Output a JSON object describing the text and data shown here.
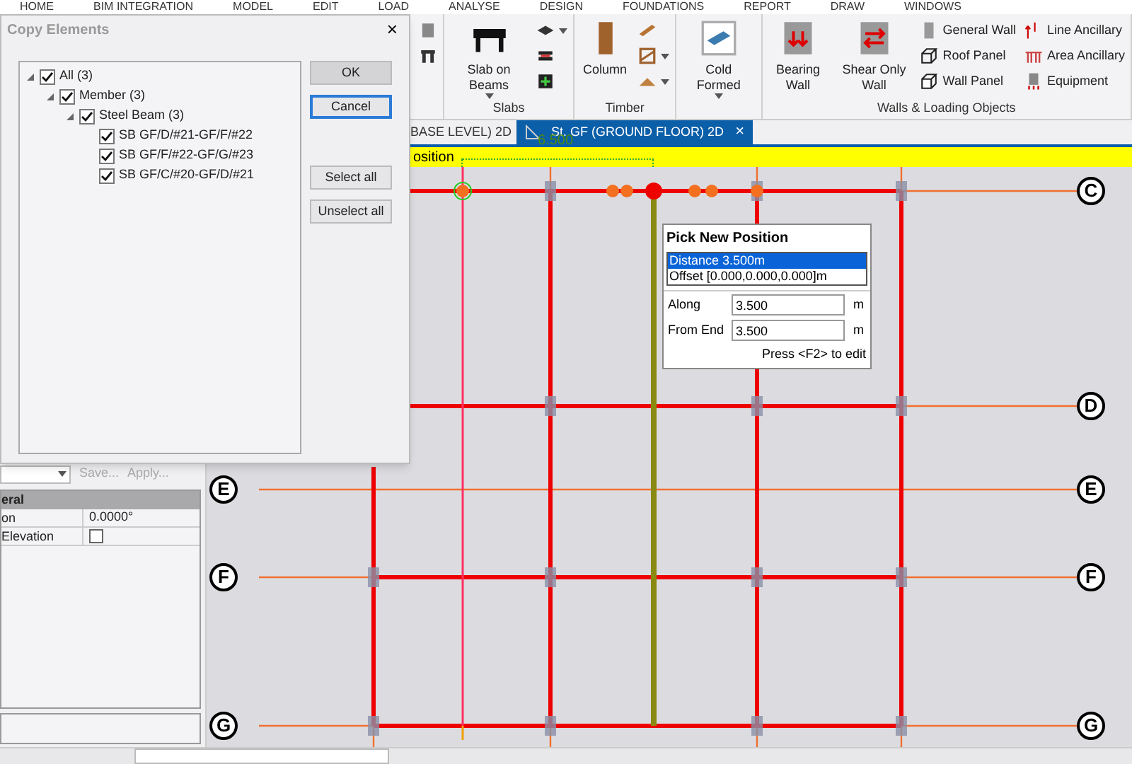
{
  "menu": [
    "HOME",
    "BIM INTEGRATION",
    "MODEL",
    "EDIT",
    "LOAD",
    "ANALYSE",
    "DESIGN",
    "FOUNDATIONS",
    "REPORT",
    "DRAW",
    "WINDOWS"
  ],
  "ribbon": {
    "groups": [
      {
        "items": [
          {
            "kind": "stack",
            "entries": [
              {
                "dropdown": false
              },
              {
                "dropdown": false
              }
            ]
          }
        ]
      },
      {
        "label": "Slabs",
        "items": [
          {
            "kind": "large",
            "label": "Slab on Beams",
            "dropdown": true
          },
          {
            "kind": "stack",
            "entries": [
              {
                "dropdown": true
              },
              {
                "dropdown": false
              },
              {
                "dropdown": false
              }
            ]
          }
        ]
      },
      {
        "label": "Timber",
        "items": [
          {
            "kind": "large",
            "label": "Column",
            "dropdown": false
          },
          {
            "kind": "stack",
            "entries": [
              {
                "dropdown": false
              },
              {
                "dropdown": true
              },
              {
                "dropdown": true
              }
            ]
          }
        ]
      },
      {
        "items": [
          {
            "kind": "large",
            "label": "Cold Formed",
            "dropdown": true
          }
        ]
      },
      {
        "label": "Walls & Loading Objects",
        "items": [
          {
            "kind": "large",
            "label": "Bearing Wall",
            "dropdown": false
          },
          {
            "kind": "large",
            "label": "Shear Only Wall",
            "dropdown": false
          },
          {
            "kind": "stack",
            "entries": [
              {
                "label": "General Wall",
                "dropdown": false
              },
              {
                "label": "Roof Panel",
                "dropdown": false
              },
              {
                "label": "Wall Panel",
                "dropdown": false
              }
            ]
          },
          {
            "kind": "stack",
            "entries": [
              {
                "label": "Line Ancillary",
                "dropdown": false
              },
              {
                "label": "Area Ancillary",
                "dropdown": false
              },
              {
                "label": "Equipment",
                "dropdown": false
              }
            ]
          }
        ]
      }
    ]
  },
  "tabs": [
    {
      "label": "BASE LEVEL) 2D",
      "selected": false
    },
    {
      "label": "St. GF (GROUND FLOOR) 2D",
      "selected": true,
      "close": "×"
    }
  ],
  "prompt_bar": {
    "text": "osition",
    "dimension": "6.500"
  },
  "grid": {
    "rows": [
      {
        "right_label": "C"
      },
      {
        "right_label": "D"
      },
      {
        "left_label": "E",
        "right_label": "E"
      },
      {
        "left_label": "F",
        "right_label": "F"
      },
      {
        "left_label": "G",
        "right_label": "G"
      }
    ]
  },
  "pick_popup": {
    "title": "Pick New Position",
    "options": [
      {
        "label": "Distance 3.500m",
        "selected": true
      },
      {
        "label": "Offset [0.000,0.000,0.000]m",
        "selected": false
      }
    ],
    "fields": [
      {
        "label": "Along",
        "value": "3.500",
        "unit": "m"
      },
      {
        "label": "From End",
        "value": "3.500",
        "unit": "m"
      }
    ],
    "hint": "Press <F2> to edit"
  },
  "left_panel": {
    "actions": [
      {
        "label": "Save...",
        "disabled": true
      },
      {
        "label": "Apply...",
        "disabled": true
      }
    ],
    "header": "eral",
    "rows": [
      {
        "kind": "text",
        "name": "on",
        "value": "0.0000°"
      },
      {
        "kind": "checkbox",
        "name": "Elevation",
        "checked": false
      }
    ]
  },
  "dialog": {
    "title": "Copy Elements",
    "close": "×",
    "tree": [
      {
        "label": "All (3)",
        "checked": true,
        "expanded": true,
        "children": [
          {
            "label": "Member (3)",
            "checked": true,
            "expanded": true,
            "children": [
              {
                "label": "Steel Beam (3)",
                "checked": true,
                "expanded": true,
                "children": [
                  {
                    "label": "SB GF/D/#21-GF/F/#22",
                    "checked": true
                  },
                  {
                    "label": "SB GF/F/#22-GF/G/#23",
                    "checked": true
                  },
                  {
                    "label": "SB GF/C/#20-GF/D/#21",
                    "checked": true
                  }
                ]
              }
            ]
          }
        ]
      }
    ],
    "buttons": [
      {
        "label": "OK",
        "default": true,
        "focused": false
      },
      {
        "label": "Cancel",
        "default": false,
        "focused": true
      }
    ],
    "selection_buttons": [
      {
        "label": "Select all",
        "default": false,
        "focused": false
      },
      {
        "label": "Unselect all",
        "default": false,
        "focused": false
      }
    ]
  }
}
